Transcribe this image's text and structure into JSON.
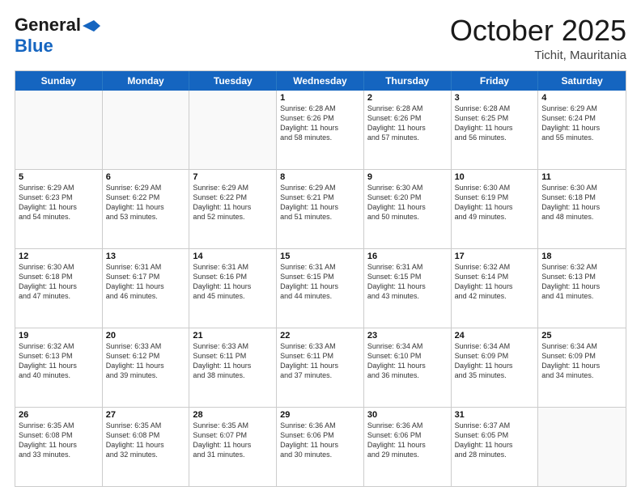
{
  "header": {
    "logo_line1": "General",
    "logo_line2": "Blue",
    "month": "October 2025",
    "location": "Tichit, Mauritania"
  },
  "weekdays": [
    "Sunday",
    "Monday",
    "Tuesday",
    "Wednesday",
    "Thursday",
    "Friday",
    "Saturday"
  ],
  "rows": [
    [
      {
        "day": "",
        "info": ""
      },
      {
        "day": "",
        "info": ""
      },
      {
        "day": "",
        "info": ""
      },
      {
        "day": "1",
        "info": "Sunrise: 6:28 AM\nSunset: 6:26 PM\nDaylight: 11 hours\nand 58 minutes."
      },
      {
        "day": "2",
        "info": "Sunrise: 6:28 AM\nSunset: 6:26 PM\nDaylight: 11 hours\nand 57 minutes."
      },
      {
        "day": "3",
        "info": "Sunrise: 6:28 AM\nSunset: 6:25 PM\nDaylight: 11 hours\nand 56 minutes."
      },
      {
        "day": "4",
        "info": "Sunrise: 6:29 AM\nSunset: 6:24 PM\nDaylight: 11 hours\nand 55 minutes."
      }
    ],
    [
      {
        "day": "5",
        "info": "Sunrise: 6:29 AM\nSunset: 6:23 PM\nDaylight: 11 hours\nand 54 minutes."
      },
      {
        "day": "6",
        "info": "Sunrise: 6:29 AM\nSunset: 6:22 PM\nDaylight: 11 hours\nand 53 minutes."
      },
      {
        "day": "7",
        "info": "Sunrise: 6:29 AM\nSunset: 6:22 PM\nDaylight: 11 hours\nand 52 minutes."
      },
      {
        "day": "8",
        "info": "Sunrise: 6:29 AM\nSunset: 6:21 PM\nDaylight: 11 hours\nand 51 minutes."
      },
      {
        "day": "9",
        "info": "Sunrise: 6:30 AM\nSunset: 6:20 PM\nDaylight: 11 hours\nand 50 minutes."
      },
      {
        "day": "10",
        "info": "Sunrise: 6:30 AM\nSunset: 6:19 PM\nDaylight: 11 hours\nand 49 minutes."
      },
      {
        "day": "11",
        "info": "Sunrise: 6:30 AM\nSunset: 6:18 PM\nDaylight: 11 hours\nand 48 minutes."
      }
    ],
    [
      {
        "day": "12",
        "info": "Sunrise: 6:30 AM\nSunset: 6:18 PM\nDaylight: 11 hours\nand 47 minutes."
      },
      {
        "day": "13",
        "info": "Sunrise: 6:31 AM\nSunset: 6:17 PM\nDaylight: 11 hours\nand 46 minutes."
      },
      {
        "day": "14",
        "info": "Sunrise: 6:31 AM\nSunset: 6:16 PM\nDaylight: 11 hours\nand 45 minutes."
      },
      {
        "day": "15",
        "info": "Sunrise: 6:31 AM\nSunset: 6:15 PM\nDaylight: 11 hours\nand 44 minutes."
      },
      {
        "day": "16",
        "info": "Sunrise: 6:31 AM\nSunset: 6:15 PM\nDaylight: 11 hours\nand 43 minutes."
      },
      {
        "day": "17",
        "info": "Sunrise: 6:32 AM\nSunset: 6:14 PM\nDaylight: 11 hours\nand 42 minutes."
      },
      {
        "day": "18",
        "info": "Sunrise: 6:32 AM\nSunset: 6:13 PM\nDaylight: 11 hours\nand 41 minutes."
      }
    ],
    [
      {
        "day": "19",
        "info": "Sunrise: 6:32 AM\nSunset: 6:13 PM\nDaylight: 11 hours\nand 40 minutes."
      },
      {
        "day": "20",
        "info": "Sunrise: 6:33 AM\nSunset: 6:12 PM\nDaylight: 11 hours\nand 39 minutes."
      },
      {
        "day": "21",
        "info": "Sunrise: 6:33 AM\nSunset: 6:11 PM\nDaylight: 11 hours\nand 38 minutes."
      },
      {
        "day": "22",
        "info": "Sunrise: 6:33 AM\nSunset: 6:11 PM\nDaylight: 11 hours\nand 37 minutes."
      },
      {
        "day": "23",
        "info": "Sunrise: 6:34 AM\nSunset: 6:10 PM\nDaylight: 11 hours\nand 36 minutes."
      },
      {
        "day": "24",
        "info": "Sunrise: 6:34 AM\nSunset: 6:09 PM\nDaylight: 11 hours\nand 35 minutes."
      },
      {
        "day": "25",
        "info": "Sunrise: 6:34 AM\nSunset: 6:09 PM\nDaylight: 11 hours\nand 34 minutes."
      }
    ],
    [
      {
        "day": "26",
        "info": "Sunrise: 6:35 AM\nSunset: 6:08 PM\nDaylight: 11 hours\nand 33 minutes."
      },
      {
        "day": "27",
        "info": "Sunrise: 6:35 AM\nSunset: 6:08 PM\nDaylight: 11 hours\nand 32 minutes."
      },
      {
        "day": "28",
        "info": "Sunrise: 6:35 AM\nSunset: 6:07 PM\nDaylight: 11 hours\nand 31 minutes."
      },
      {
        "day": "29",
        "info": "Sunrise: 6:36 AM\nSunset: 6:06 PM\nDaylight: 11 hours\nand 30 minutes."
      },
      {
        "day": "30",
        "info": "Sunrise: 6:36 AM\nSunset: 6:06 PM\nDaylight: 11 hours\nand 29 minutes."
      },
      {
        "day": "31",
        "info": "Sunrise: 6:37 AM\nSunset: 6:05 PM\nDaylight: 11 hours\nand 28 minutes."
      },
      {
        "day": "",
        "info": ""
      }
    ]
  ]
}
